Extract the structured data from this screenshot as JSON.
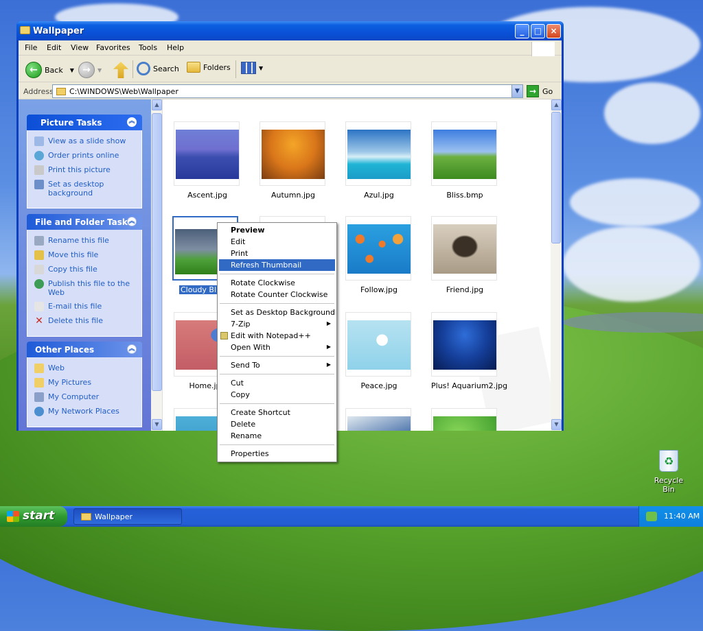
{
  "window": {
    "title": "Wallpaper",
    "controls": {
      "minimize": "_",
      "maximize": "□",
      "close": "×"
    }
  },
  "menu": [
    "File",
    "Edit",
    "View",
    "Favorites",
    "Tools",
    "Help"
  ],
  "toolbar": {
    "back": "Back",
    "search": "Search",
    "folders": "Folders"
  },
  "address": {
    "label": "Address",
    "value": "C:\\WINDOWS\\Web\\Wallpaper",
    "go": "Go"
  },
  "taskpane": {
    "picture_tasks": {
      "title": "Picture Tasks",
      "items": [
        "View as a slide show",
        "Order prints online",
        "Print this picture",
        "Set as desktop background"
      ]
    },
    "file_tasks": {
      "title": "File and Folder Tasks",
      "items": [
        "Rename this file",
        "Move this file",
        "Copy this file",
        "Publish this file to the Web",
        "E-mail this file",
        "Delete this file"
      ]
    },
    "other_places": {
      "title": "Other Places",
      "items": [
        "Web",
        "My Pictures",
        "My Computer",
        "My Network Places"
      ]
    }
  },
  "files": [
    {
      "name": "Ascent.jpg",
      "icon": "mountain-thumbnail"
    },
    {
      "name": "Autumn.jpg",
      "icon": "autumn-thumbnail"
    },
    {
      "name": "Azul.jpg",
      "icon": "beach-thumbnail"
    },
    {
      "name": "Bliss.bmp",
      "icon": "bliss-thumbnail"
    },
    {
      "name": "Cloudy Bliss",
      "icon": "cloudy-thumbnail",
      "selected": true
    },
    {
      "name": "",
      "icon": "blue-thumbnail"
    },
    {
      "name": "Follow.jpg",
      "icon": "fish-thumbnail"
    },
    {
      "name": "Friend.jpg",
      "icon": "dog-thumbnail"
    },
    {
      "name": "Home.jpg",
      "icon": "home-thumbnail"
    },
    {
      "name": "",
      "icon": "hidden-thumbnail"
    },
    {
      "name": "Peace.jpg",
      "icon": "peace-thumbnail"
    },
    {
      "name": "Plus! Aquarium2.jpg",
      "icon": "aquarium-thumbnail"
    }
  ],
  "context_menu": {
    "items": [
      {
        "label": "Preview",
        "bold": true
      },
      {
        "label": "Edit"
      },
      {
        "label": "Print"
      },
      {
        "label": "Refresh Thumbnail",
        "highlighted": true
      },
      {
        "label": "Rotate Clockwise"
      },
      {
        "label": "Rotate Counter Clockwise"
      },
      {
        "label": "Set as Desktop Background"
      },
      {
        "label": "7-Zip",
        "submenu": true
      },
      {
        "label": "Edit with Notepad++"
      },
      {
        "label": "Open With",
        "submenu": true
      },
      {
        "label": "Send To",
        "submenu": true
      },
      {
        "label": "Cut"
      },
      {
        "label": "Copy"
      },
      {
        "label": "Create Shortcut"
      },
      {
        "label": "Delete"
      },
      {
        "label": "Rename"
      },
      {
        "label": "Properties"
      }
    ]
  },
  "desktop": {
    "recycle_bin": "Recycle Bin"
  },
  "taskbar": {
    "start": "start",
    "task": "Wallpaper",
    "clock": "11:40 AM"
  },
  "colors": {
    "selection": "#316ac5",
    "titlebar": "#0a51d8",
    "link": "#215dc6"
  }
}
